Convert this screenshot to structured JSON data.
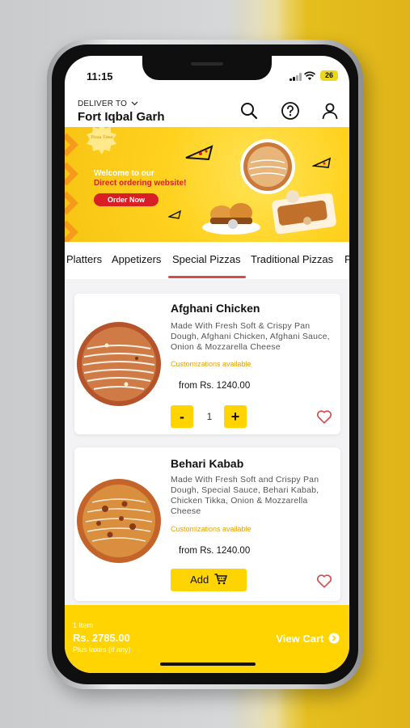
{
  "status_bar": {
    "time": "11:15",
    "battery": "26"
  },
  "header": {
    "deliver_to_label": "DELIVER TO",
    "location": "Fort Iqbal Garh",
    "icons": [
      "search-icon",
      "help-icon",
      "profile-icon"
    ]
  },
  "banner": {
    "welcome": "Welcome to our",
    "direct": "Direct ordering website!",
    "cta": "Order Now"
  },
  "tabs": [
    {
      "label": "Platters"
    },
    {
      "label": "Appetizers"
    },
    {
      "label": "Special Pizzas",
      "active": true
    },
    {
      "label": "Traditional Pizzas"
    },
    {
      "label": "P"
    }
  ],
  "products": [
    {
      "name": "Afghani Chicken",
      "description": "Made With Fresh Soft & Crispy  Pan Dough, Afghani Chicken, Afghani Sauce, Onion & Mozzarella Cheese",
      "customizations": "Customizations available",
      "price": "from Rs. 1240.00",
      "quantity": "1",
      "minus": "-",
      "plus": "+"
    },
    {
      "name": "Behari Kabab",
      "description": "Made With Fresh Soft and Crispy Pan Dough, Special Sauce, Behari Kabab, Chicken Tikka, Onion & Mozzarella Cheese",
      "customizations": "Customizations available",
      "price": "from Rs. 1240.00",
      "add_label": "Add"
    }
  ],
  "cart": {
    "items": "1 Item",
    "total": "Rs. 2785.00",
    "tax_note": "Plus taxes (if any)",
    "view_label": "View Cart"
  },
  "colors": {
    "accent_yellow": "#ffd400",
    "brand_red": "#d91f26",
    "tab_underline": "#d44b4b",
    "custom_text": "#e3a30a"
  }
}
